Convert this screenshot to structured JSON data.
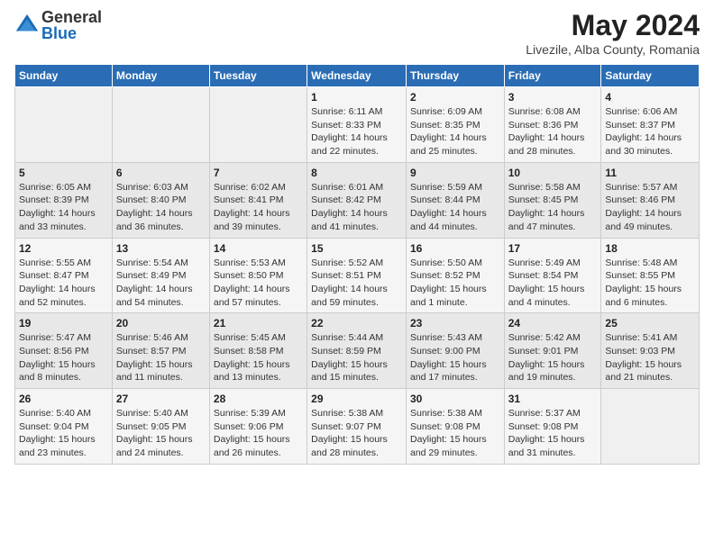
{
  "logo": {
    "general": "General",
    "blue": "Blue"
  },
  "header": {
    "month_year": "May 2024",
    "location": "Livezile, Alba County, Romania"
  },
  "weekdays": [
    "Sunday",
    "Monday",
    "Tuesday",
    "Wednesday",
    "Thursday",
    "Friday",
    "Saturday"
  ],
  "weeks": [
    [
      {
        "day": "",
        "info": ""
      },
      {
        "day": "",
        "info": ""
      },
      {
        "day": "",
        "info": ""
      },
      {
        "day": "1",
        "info": "Sunrise: 6:11 AM\nSunset: 8:33 PM\nDaylight: 14 hours\nand 22 minutes."
      },
      {
        "day": "2",
        "info": "Sunrise: 6:09 AM\nSunset: 8:35 PM\nDaylight: 14 hours\nand 25 minutes."
      },
      {
        "day": "3",
        "info": "Sunrise: 6:08 AM\nSunset: 8:36 PM\nDaylight: 14 hours\nand 28 minutes."
      },
      {
        "day": "4",
        "info": "Sunrise: 6:06 AM\nSunset: 8:37 PM\nDaylight: 14 hours\nand 30 minutes."
      }
    ],
    [
      {
        "day": "5",
        "info": "Sunrise: 6:05 AM\nSunset: 8:39 PM\nDaylight: 14 hours\nand 33 minutes."
      },
      {
        "day": "6",
        "info": "Sunrise: 6:03 AM\nSunset: 8:40 PM\nDaylight: 14 hours\nand 36 minutes."
      },
      {
        "day": "7",
        "info": "Sunrise: 6:02 AM\nSunset: 8:41 PM\nDaylight: 14 hours\nand 39 minutes."
      },
      {
        "day": "8",
        "info": "Sunrise: 6:01 AM\nSunset: 8:42 PM\nDaylight: 14 hours\nand 41 minutes."
      },
      {
        "day": "9",
        "info": "Sunrise: 5:59 AM\nSunset: 8:44 PM\nDaylight: 14 hours\nand 44 minutes."
      },
      {
        "day": "10",
        "info": "Sunrise: 5:58 AM\nSunset: 8:45 PM\nDaylight: 14 hours\nand 47 minutes."
      },
      {
        "day": "11",
        "info": "Sunrise: 5:57 AM\nSunset: 8:46 PM\nDaylight: 14 hours\nand 49 minutes."
      }
    ],
    [
      {
        "day": "12",
        "info": "Sunrise: 5:55 AM\nSunset: 8:47 PM\nDaylight: 14 hours\nand 52 minutes."
      },
      {
        "day": "13",
        "info": "Sunrise: 5:54 AM\nSunset: 8:49 PM\nDaylight: 14 hours\nand 54 minutes."
      },
      {
        "day": "14",
        "info": "Sunrise: 5:53 AM\nSunset: 8:50 PM\nDaylight: 14 hours\nand 57 minutes."
      },
      {
        "day": "15",
        "info": "Sunrise: 5:52 AM\nSunset: 8:51 PM\nDaylight: 14 hours\nand 59 minutes."
      },
      {
        "day": "16",
        "info": "Sunrise: 5:50 AM\nSunset: 8:52 PM\nDaylight: 15 hours\nand 1 minute."
      },
      {
        "day": "17",
        "info": "Sunrise: 5:49 AM\nSunset: 8:54 PM\nDaylight: 15 hours\nand 4 minutes."
      },
      {
        "day": "18",
        "info": "Sunrise: 5:48 AM\nSunset: 8:55 PM\nDaylight: 15 hours\nand 6 minutes."
      }
    ],
    [
      {
        "day": "19",
        "info": "Sunrise: 5:47 AM\nSunset: 8:56 PM\nDaylight: 15 hours\nand 8 minutes."
      },
      {
        "day": "20",
        "info": "Sunrise: 5:46 AM\nSunset: 8:57 PM\nDaylight: 15 hours\nand 11 minutes."
      },
      {
        "day": "21",
        "info": "Sunrise: 5:45 AM\nSunset: 8:58 PM\nDaylight: 15 hours\nand 13 minutes."
      },
      {
        "day": "22",
        "info": "Sunrise: 5:44 AM\nSunset: 8:59 PM\nDaylight: 15 hours\nand 15 minutes."
      },
      {
        "day": "23",
        "info": "Sunrise: 5:43 AM\nSunset: 9:00 PM\nDaylight: 15 hours\nand 17 minutes."
      },
      {
        "day": "24",
        "info": "Sunrise: 5:42 AM\nSunset: 9:01 PM\nDaylight: 15 hours\nand 19 minutes."
      },
      {
        "day": "25",
        "info": "Sunrise: 5:41 AM\nSunset: 9:03 PM\nDaylight: 15 hours\nand 21 minutes."
      }
    ],
    [
      {
        "day": "26",
        "info": "Sunrise: 5:40 AM\nSunset: 9:04 PM\nDaylight: 15 hours\nand 23 minutes."
      },
      {
        "day": "27",
        "info": "Sunrise: 5:40 AM\nSunset: 9:05 PM\nDaylight: 15 hours\nand 24 minutes."
      },
      {
        "day": "28",
        "info": "Sunrise: 5:39 AM\nSunset: 9:06 PM\nDaylight: 15 hours\nand 26 minutes."
      },
      {
        "day": "29",
        "info": "Sunrise: 5:38 AM\nSunset: 9:07 PM\nDaylight: 15 hours\nand 28 minutes."
      },
      {
        "day": "30",
        "info": "Sunrise: 5:38 AM\nSunset: 9:08 PM\nDaylight: 15 hours\nand 29 minutes."
      },
      {
        "day": "31",
        "info": "Sunrise: 5:37 AM\nSunset: 9:08 PM\nDaylight: 15 hours\nand 31 minutes."
      },
      {
        "day": "",
        "info": ""
      }
    ]
  ]
}
